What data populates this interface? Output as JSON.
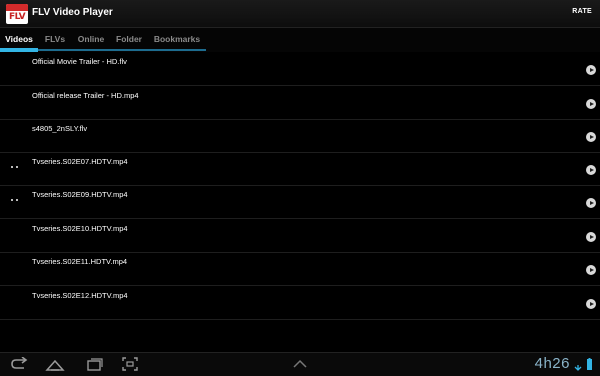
{
  "app": {
    "logo_text": "FLV",
    "title": "FLV Video Player",
    "rate_label": "RATE"
  },
  "tabs": [
    {
      "label": "Videos",
      "active": true
    },
    {
      "label": "FLVs",
      "active": false
    },
    {
      "label": "Online",
      "active": false
    },
    {
      "label": "Folder",
      "active": false
    },
    {
      "label": "Bookmarks",
      "active": false
    }
  ],
  "videos": [
    {
      "title": "Official Movie Trailer - HD.flv",
      "has_thumbnail": false
    },
    {
      "title": "Official release Trailer - HD.mp4",
      "has_thumbnail": false
    },
    {
      "title": "s4805_2nSLY.flv",
      "has_thumbnail": false
    },
    {
      "title": "Tvseries.S02E07.HDTV.mp4",
      "has_thumbnail": true
    },
    {
      "title": "Tvseries.S02E09.HDTV.mp4",
      "has_thumbnail": true
    },
    {
      "title": "Tvseries.S02E10.HDTV.mp4",
      "has_thumbnail": false
    },
    {
      "title": "Tvseries.S02E11.HDTV.mp4",
      "has_thumbnail": false
    },
    {
      "title": "Tvseries.S02E12.HDTV.mp4",
      "has_thumbnail": false
    }
  ],
  "navbar": {
    "buttons": [
      "back-icon",
      "home-icon",
      "recent-apps-icon",
      "screenshot-icon",
      "expand-up-icon"
    ],
    "clock": "4h26"
  },
  "colors": {
    "accent": "#33b5e5",
    "logo_red": "#d32b2b",
    "background": "#000000"
  }
}
